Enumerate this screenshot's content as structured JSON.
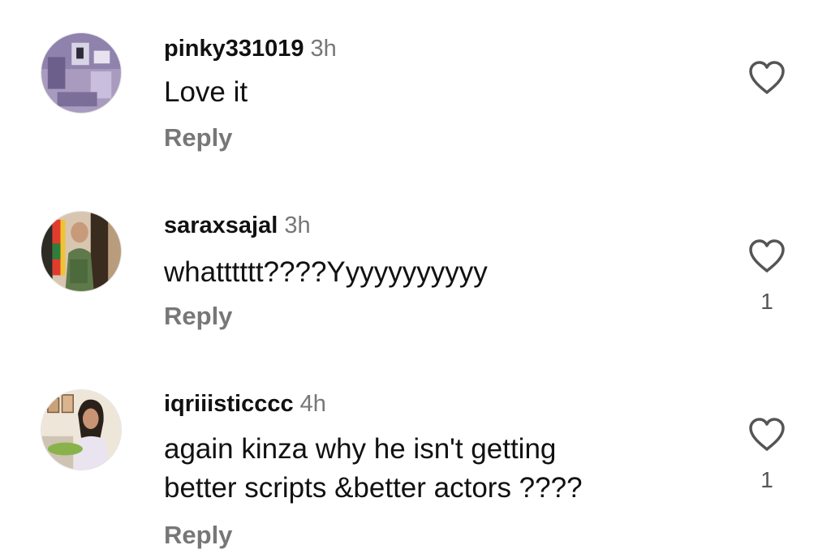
{
  "comments": [
    {
      "username": "pinky331019",
      "time": "3h",
      "text": [
        "Love it"
      ],
      "reply_label": "Reply",
      "likes": ""
    },
    {
      "username": "saraxsajal",
      "time": "3h",
      "text": [
        "whatttttt????Yyyyyyyyyyy"
      ],
      "reply_label": "Reply",
      "likes": "1"
    },
    {
      "username": "iqriiisticccc",
      "time": "4h",
      "text": [
        "again kinza why he isn't getting",
        "better scripts &better actors ????"
      ],
      "reply_label": "Reply",
      "likes": "1"
    }
  ],
  "icons": {
    "like": "heart-outline-icon"
  }
}
